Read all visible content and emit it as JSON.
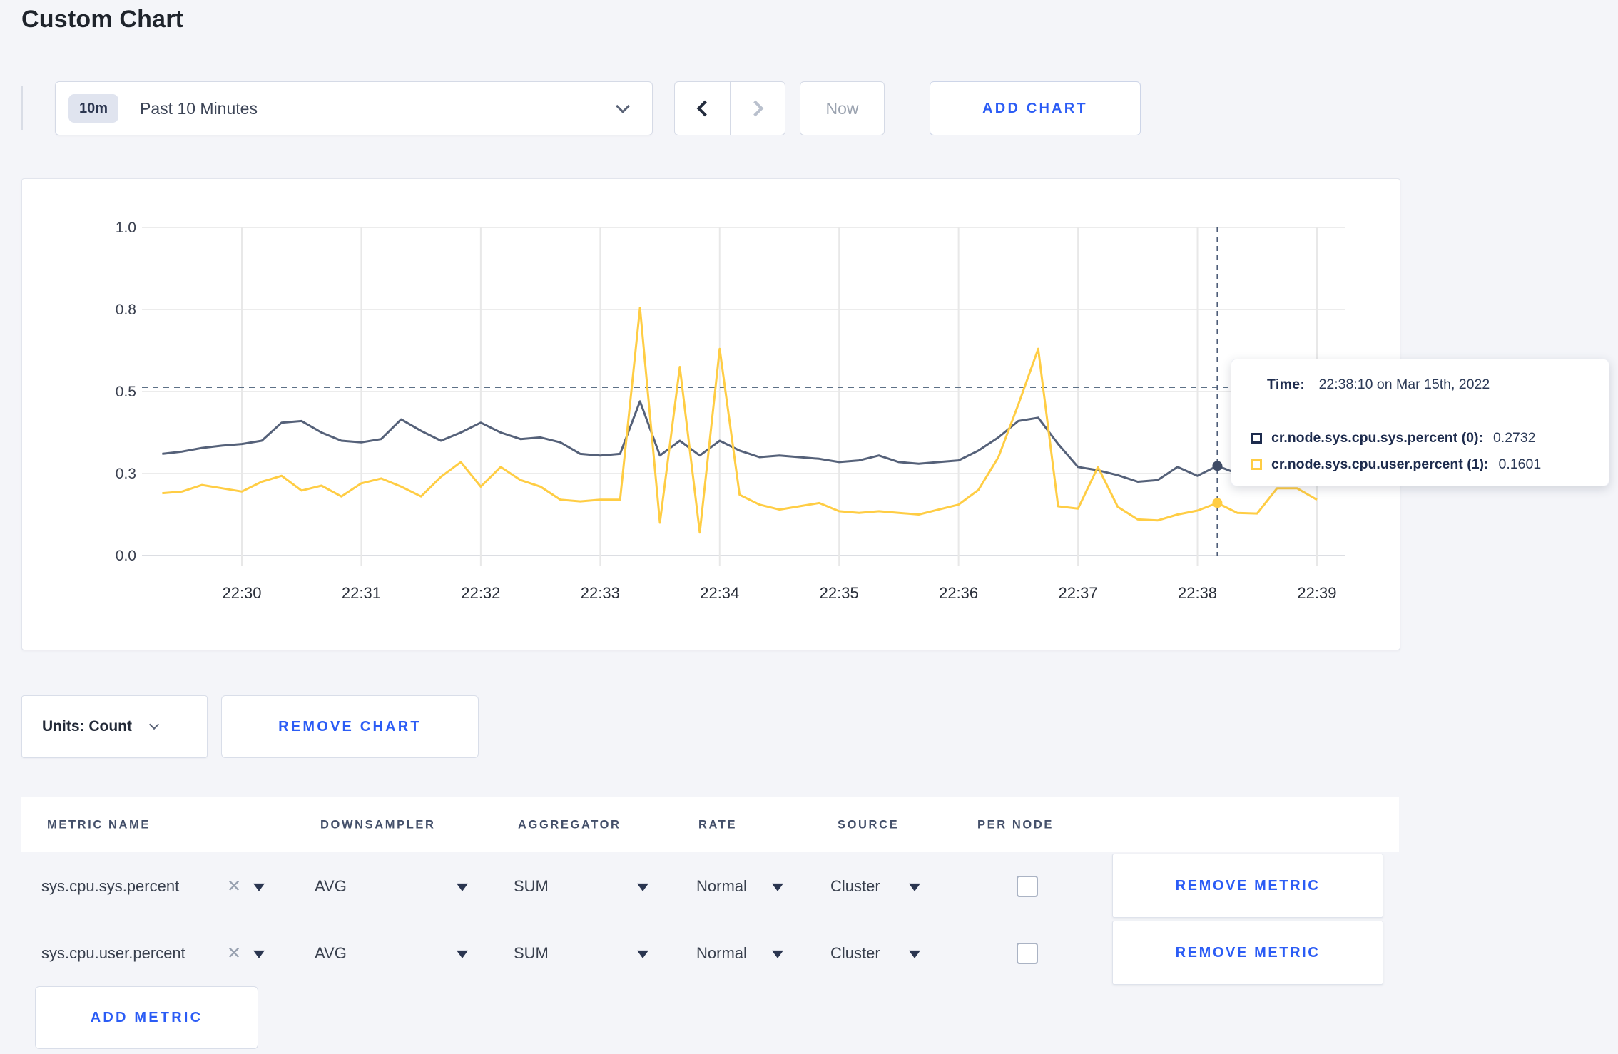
{
  "page": {
    "title": "Custom Chart"
  },
  "toolbar": {
    "time_range": {
      "badge": "10m",
      "label": "Past 10 Minutes"
    },
    "now_label": "Now",
    "add_chart_label": "ADD CHART"
  },
  "chart_controls": {
    "units_label": "Units: Count",
    "remove_chart_label": "REMOVE CHART"
  },
  "metrics_table": {
    "headers": [
      "METRIC NAME",
      "DOWNSAMPLER",
      "AGGREGATOR",
      "RATE",
      "SOURCE",
      "PER NODE"
    ],
    "rows": [
      {
        "metric_name": "sys.cpu.sys.percent",
        "downsampler": "AVG",
        "aggregator": "SUM",
        "rate": "Normal",
        "source": "Cluster",
        "per_node_checked": false,
        "remove_label": "REMOVE METRIC"
      },
      {
        "metric_name": "sys.cpu.user.percent",
        "downsampler": "AVG",
        "aggregator": "SUM",
        "rate": "Normal",
        "source": "Cluster",
        "per_node_checked": false,
        "remove_label": "REMOVE METRIC"
      }
    ],
    "add_metric_label": "ADD METRIC"
  },
  "chart_data": {
    "type": "line",
    "title": "",
    "xlabel": "",
    "ylabel": "",
    "ylim": [
      0,
      1
    ],
    "grid": true,
    "legend_position": "tooltip",
    "y_ticks": [
      {
        "value": 0.0,
        "label": "0.0"
      },
      {
        "value": 0.25,
        "label": "0.3"
      },
      {
        "value": 0.5,
        "label": "0.5"
      },
      {
        "value": 0.75,
        "label": "0.8"
      },
      {
        "value": 1.0,
        "label": "1.0"
      }
    ],
    "x_ticks": [
      "22:30",
      "22:31",
      "22:32",
      "22:33",
      "22:34",
      "22:35",
      "22:36",
      "22:37",
      "22:38",
      "22:39"
    ],
    "start_time": "22:29:20",
    "interval_seconds": 10,
    "series": [
      {
        "name": "cr.node.sys.cpu.sys.percent",
        "color": "#556179",
        "dot_color": "#3f4c66",
        "values": [
          0.31,
          0.317,
          0.328,
          0.335,
          0.34,
          0.35,
          0.405,
          0.41,
          0.375,
          0.35,
          0.345,
          0.355,
          0.415,
          0.38,
          0.35,
          0.375,
          0.405,
          0.375,
          0.355,
          0.36,
          0.345,
          0.31,
          0.305,
          0.31,
          0.47,
          0.305,
          0.35,
          0.305,
          0.35,
          0.32,
          0.3,
          0.305,
          0.3,
          0.295,
          0.285,
          0.29,
          0.305,
          0.285,
          0.28,
          0.285,
          0.29,
          0.32,
          0.36,
          0.41,
          0.42,
          0.34,
          0.27,
          0.26,
          0.245,
          0.225,
          0.23,
          0.27,
          0.243,
          0.2732,
          0.25,
          0.26,
          0.265,
          0.27,
          0.28
        ]
      },
      {
        "name": "cr.node.sys.cpu.user.percent",
        "color": "#ffcd44",
        "dot_color": "#ffcd44",
        "values": [
          0.19,
          0.195,
          0.215,
          0.205,
          0.195,
          0.225,
          0.243,
          0.198,
          0.213,
          0.18,
          0.22,
          0.235,
          0.21,
          0.18,
          0.24,
          0.285,
          0.21,
          0.27,
          0.23,
          0.21,
          0.17,
          0.165,
          0.17,
          0.17,
          0.755,
          0.1,
          0.575,
          0.07,
          0.63,
          0.185,
          0.155,
          0.14,
          0.15,
          0.16,
          0.135,
          0.13,
          0.135,
          0.13,
          0.125,
          0.14,
          0.155,
          0.2,
          0.3,
          0.46,
          0.63,
          0.15,
          0.143,
          0.27,
          0.148,
          0.11,
          0.107,
          0.125,
          0.137,
          0.1601,
          0.13,
          0.128,
          0.205,
          0.205,
          0.17
        ]
      }
    ],
    "crosshair": {
      "time": "22:38:10",
      "hline_value": 0.513
    },
    "tooltip": {
      "time_label": "Time:",
      "time_value": "22:38:10 on Mar 15th, 2022",
      "rows": [
        {
          "swatch_color": "#1d2b4d",
          "name": "cr.node.sys.cpu.sys.percent (0):",
          "value": "0.2732"
        },
        {
          "swatch_color": "#ffcd44",
          "name": "cr.node.sys.cpu.user.percent (1):",
          "value": "0.1601"
        }
      ]
    }
  }
}
